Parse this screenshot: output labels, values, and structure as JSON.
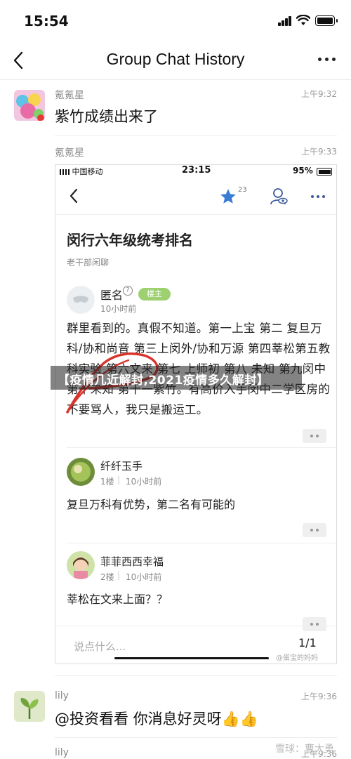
{
  "status_bar": {
    "time": "15:54"
  },
  "nav": {
    "title": "Group Chat History"
  },
  "messages": [
    {
      "sender": "氪氪星",
      "time": "上午9:32",
      "text": "紫竹成绩出来了"
    },
    {
      "sender": "氪氪星",
      "time": "上午9:33"
    },
    {
      "sender": "lily",
      "time": "上午9:36",
      "text": "@投资看看 你消息好灵呀👍👍"
    },
    {
      "sender": "lily",
      "time": "上午9:36"
    }
  ],
  "embedded": {
    "status": {
      "carrier": "中国移动",
      "time": "23:15",
      "battery": "95%"
    },
    "star_count": "23",
    "post": {
      "title": "闵行六年级统考排名",
      "forum": "老干部闲聊",
      "author": "匿名",
      "badge": "楼主",
      "time": "10小时前",
      "body": "群里看到的。真假不知道。第一上宝 第二 复旦万科/协和尚音 第三上闵外/协和万源 第四莘松第五教科实验 第六文来 第七 上师初 第八 未知 第九闵中 第十未知 第十一紫竹。有高价入手闵中二学区房的不要骂人，我只是搬运工。"
    },
    "replies": [
      {
        "name": "纤纤玉手",
        "floor": "1楼",
        "time": "10小时前",
        "text": "复旦万科有优势，第二名有可能的"
      },
      {
        "name": "菲菲西西幸福",
        "floor": "2楼",
        "time": "10小时前",
        "text": "莘松在文来上面？？"
      }
    ],
    "input_placeholder": "说点什么...",
    "pager": "1/1",
    "watermark": "@蛋宝的妈妈"
  },
  "banner": "【疫情几近解封,2021疫情多久解封】",
  "watermark": "雪球：曹大勇",
  "colors": {
    "badge_green": "#9dd06f",
    "star_blue": "#3a7bd5",
    "scribble_red": "#d9342b"
  }
}
